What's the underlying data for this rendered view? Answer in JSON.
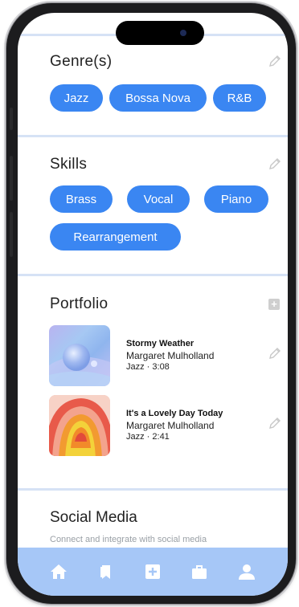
{
  "genres": {
    "title": "Genre(s)",
    "chips": [
      "Jazz",
      "Bossa Nova",
      "R&B"
    ]
  },
  "skills": {
    "title": "Skills",
    "chips": [
      "Brass",
      "Vocal",
      "Piano",
      "Rearrangement"
    ]
  },
  "portfolio": {
    "title": "Portfolio",
    "add_icon": "plus-icon",
    "tracks": [
      {
        "title": "Stormy Weather",
        "artist": "Margaret Mulholland",
        "meta": "Jazz · 3:08"
      },
      {
        "title": "It's a Lovely Day Today",
        "artist": "Margaret Mulholland",
        "meta": "Jazz · 2:41"
      }
    ]
  },
  "social": {
    "title": "Social Media",
    "subtitle": "Connect and integrate with social media"
  },
  "nav": {
    "items": [
      "home-icon",
      "bookmark-icon",
      "plus-square-icon",
      "briefcase-icon",
      "profile-icon"
    ]
  },
  "colors": {
    "accent": "#3a86f2",
    "nav_bg": "#a6c7f7",
    "divider": "#d6e2f5"
  }
}
